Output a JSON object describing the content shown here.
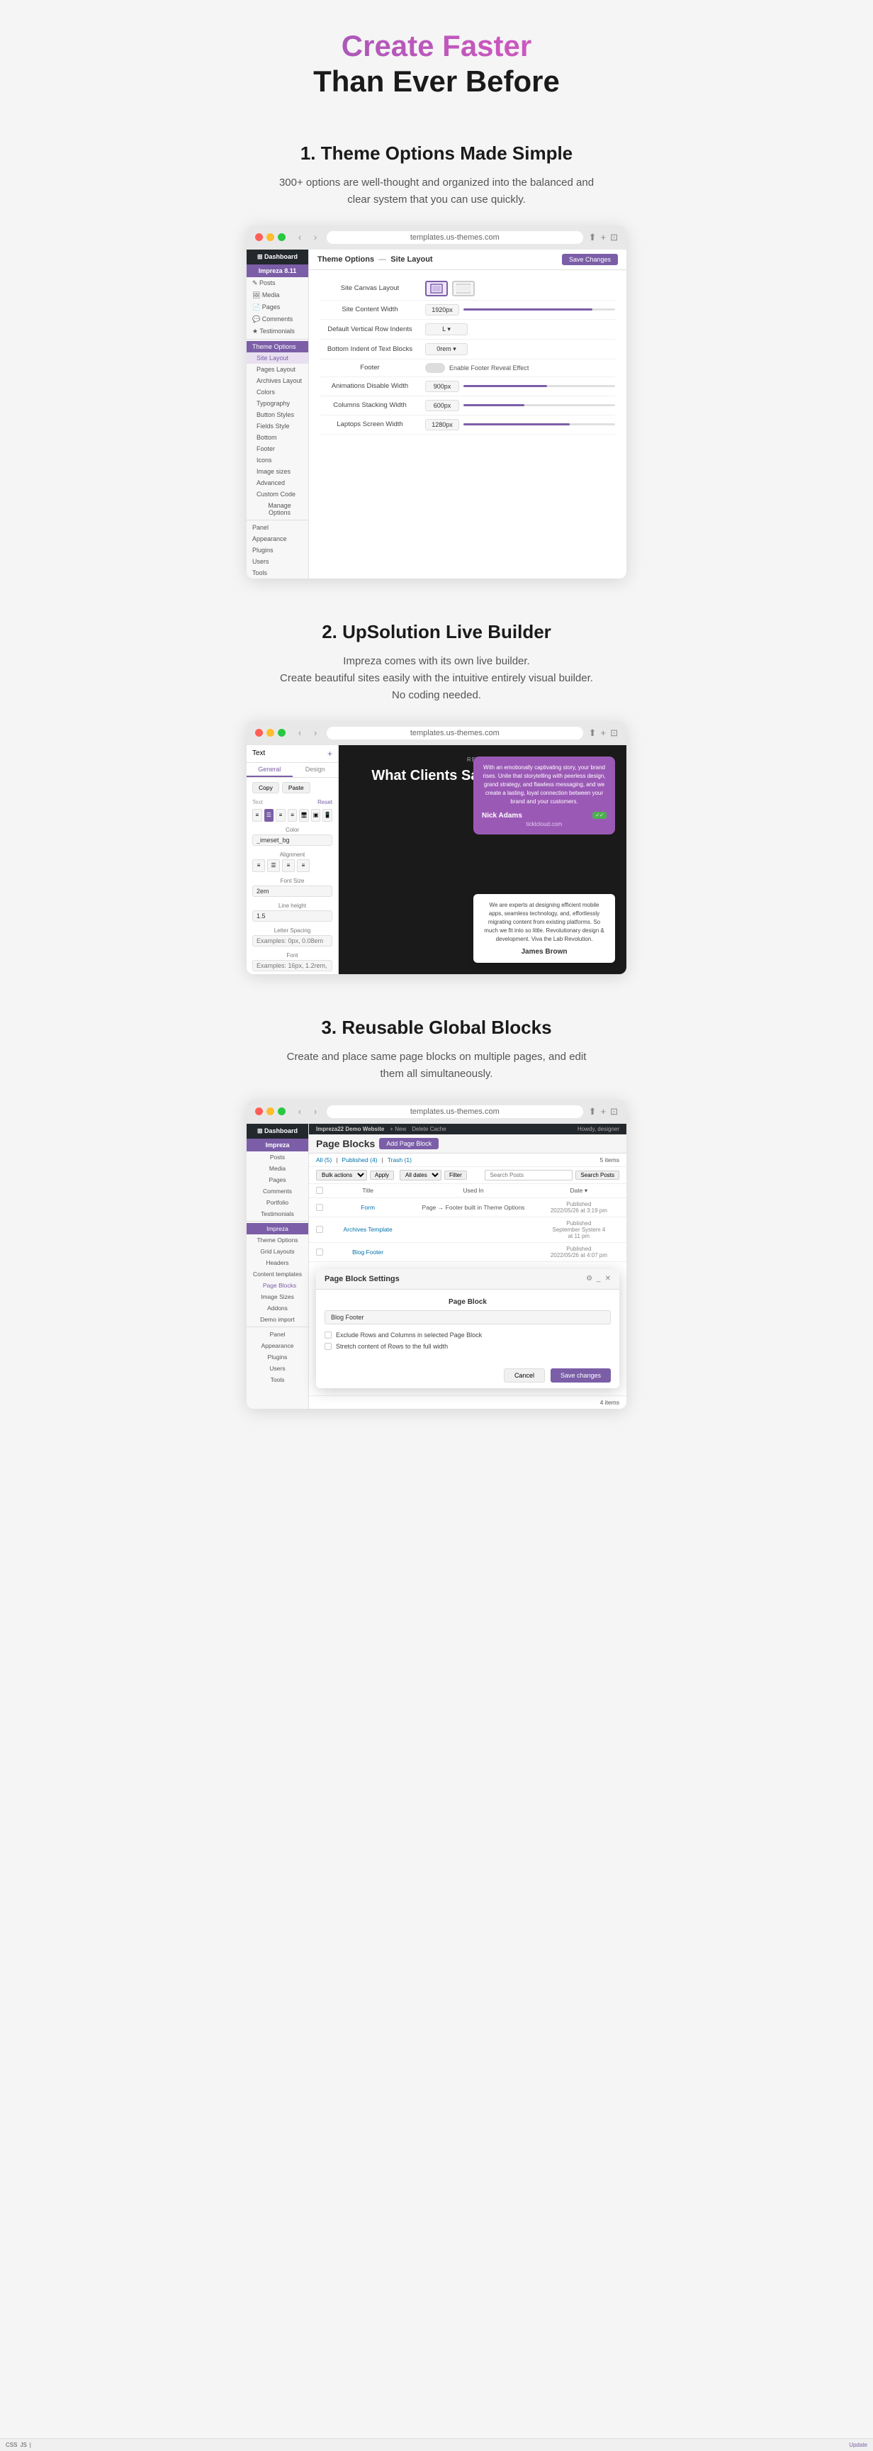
{
  "hero": {
    "line1": "Create Faster",
    "line2": "Than Ever Before"
  },
  "section1": {
    "title": "1. Theme Options Made Simple",
    "description": "300+ options are well-thought and organized into the balanced and clear system that you can use quickly.",
    "browser_url": "templates.us-themes.com",
    "breadcrumb_prefix": "Theme Options",
    "breadcrumb_arrow": "→",
    "breadcrumb_page": "Site Layout",
    "save_btn": "Save Changes",
    "sidebar": {
      "site_title": "Impreza 8.11",
      "items": [
        {
          "label": "Dashboard",
          "icon": "⊞"
        },
        {
          "label": "Posts",
          "icon": "✎"
        },
        {
          "label": "Media",
          "icon": "🖼"
        },
        {
          "label": "Pages",
          "icon": "📄"
        },
        {
          "label": "Comments",
          "icon": "💬"
        },
        {
          "label": "Testimonials",
          "icon": "★"
        },
        {
          "label": "Theme Options",
          "active": true
        },
        {
          "label": "Site Layout",
          "sub": true,
          "active_sub": true
        },
        {
          "label": "Pages Layout",
          "sub": true
        },
        {
          "label": "Archives Layout",
          "sub": true
        },
        {
          "label": "Colors",
          "sub": true
        },
        {
          "label": "Typography",
          "sub": true
        },
        {
          "label": "Button Styles",
          "sub": true
        },
        {
          "label": "Fields Style",
          "sub": true
        },
        {
          "label": "Bottom",
          "sub": true
        },
        {
          "label": "Footer",
          "sub": true
        },
        {
          "label": "Icons",
          "sub": true
        },
        {
          "label": "Image sizes",
          "sub": true
        },
        {
          "label": "Advanced",
          "sub": true
        },
        {
          "label": "Custom Code",
          "sub": true
        },
        {
          "label": "Manage Options",
          "sub": true
        },
        {
          "label": "Panel"
        },
        {
          "label": "Appearance"
        },
        {
          "label": "Plugins"
        },
        {
          "label": "Users"
        },
        {
          "label": "Tools"
        }
      ]
    },
    "rows": [
      {
        "label": "Site Canvas Layout",
        "type": "layout_buttons"
      },
      {
        "label": "Site Content Width",
        "value": "1920px",
        "type": "slider",
        "fill": 85
      },
      {
        "label": "Default Vertical Row Indents",
        "value": "L",
        "type": "select"
      },
      {
        "label": "Bottom Indent of Text Blocks",
        "value": "0rem",
        "type": "select"
      },
      {
        "label": "Footer",
        "type": "toggle",
        "toggle_label": "Enable Footer Reveal Effect"
      },
      {
        "label": "Animations Disable Width",
        "value": "900px",
        "type": "slider",
        "fill": 55
      },
      {
        "label": "Columns Stacking Width",
        "value": "600px",
        "type": "slider",
        "fill": 40
      },
      {
        "label": "Laptops Screen Width",
        "value": "1280px",
        "type": "slider",
        "fill": 70
      }
    ]
  },
  "section2": {
    "title": "2. UpSolution Live Builder",
    "description1": "Impreza comes with its own live builder.",
    "description2": "Create beautiful sites easily with the intuitive entirely visual builder. No coding needed.",
    "browser_url": "templates.us-themes.com",
    "sidebar": {
      "active_tab": "Text",
      "tabs": [
        "General",
        "Design"
      ],
      "copy_label": "Copy",
      "paste_label": "Paste",
      "text_label": "Text",
      "reset_label": "Reset",
      "color_label": "Color",
      "color_value": "_imeset_bg",
      "alignment_label": "Alignment",
      "font_size_label": "Font Size",
      "font_size_value": "2em",
      "line_height_label": "Line height",
      "line_height_value": "1.5",
      "letter_spacing_label": "Letter Spacing",
      "font_label": "Font"
    },
    "main": {
      "review_tag": "REVIEWS",
      "heading": "What Clients Say About My Work",
      "card1": {
        "text": "With an emotionally captivating story, your brand rises. Unite that storytelling with peerless design, grand strategy, and flawless messaging, and we create a lasting, loyal connection between your brand and your customers.",
        "name": "Nick Adams",
        "site": "ticktcloud.com"
      },
      "card2": {
        "text": "We are experts at designing efficient mobile apps, seamless technology, and, effortlessly migrating content from existing platforms. So much we fit into so little. Revolutionary design & development. Viva the Lab Revolution.",
        "name": "James Brown"
      }
    }
  },
  "section3": {
    "title": "3. Reusable Global Blocks",
    "description": "Create and place same page blocks on multiple pages, and edit them all simultaneously.",
    "browser_url": "templates.us-themes.com",
    "admin_bar_items": [
      "Impreza22 Demo Website",
      "+ New",
      "Delete Cache",
      "Howdy, designer"
    ],
    "page_title": "Page Blocks",
    "add_btn": "Add Page Block",
    "filter_options": [
      "All (5)",
      "Published (4)",
      "Trash (1)",
      "All dates",
      "Filter"
    ],
    "bulk_actions": "Bulk actions",
    "apply": "Apply",
    "search_placeholder": "Search Posts",
    "items_count": "5 items",
    "table_headers": [
      "Title",
      "Used In",
      "Date"
    ],
    "table_rows": [
      {
        "title": "Title",
        "used_in": "",
        "date": "Date ▾"
      },
      {
        "title": "Form",
        "used_in": "Page → Footer built in Theme Options",
        "date": "Published\n2022/05/26 at 3:19 pm"
      },
      {
        "title": "Archives Template",
        "used_in": "",
        "date": "Published\nSeptember System 4\nat 11 pm"
      },
      {
        "title": "Blog Footer",
        "used_in": "",
        "date": "Published\n2022/05/26 at 4:07 pm"
      }
    ],
    "modal": {
      "title": "Page Block Settings",
      "field_label": "Page Block",
      "field_value": "Blog Footer",
      "checkbox1": "Exclude Rows and Columns in selected Page Block",
      "checkbox2": "Stretch content of Rows to the full width",
      "cancel_btn": "Cancel",
      "save_btn": "Save changes"
    },
    "sidebar_items": [
      {
        "label": "Dashboard"
      },
      {
        "label": "Posts"
      },
      {
        "label": "Media"
      },
      {
        "label": "Pages"
      },
      {
        "label": "Comments"
      },
      {
        "label": "Portfolio"
      },
      {
        "label": "Testimonials"
      },
      {
        "label": "Impreza",
        "active": true
      },
      {
        "label": "Theme Options"
      },
      {
        "label": "Grid Layouts"
      },
      {
        "label": "Headers"
      },
      {
        "label": "Content templates"
      },
      {
        "label": "Page Blocks",
        "sub": true,
        "active_sub": true
      },
      {
        "label": "Image Sizes"
      },
      {
        "label": "Addons"
      },
      {
        "label": "Demo import"
      },
      {
        "label": "Panel"
      },
      {
        "label": "Appearance"
      },
      {
        "label": "Plugins"
      },
      {
        "label": "Users"
      },
      {
        "label": "Tools"
      }
    ]
  }
}
